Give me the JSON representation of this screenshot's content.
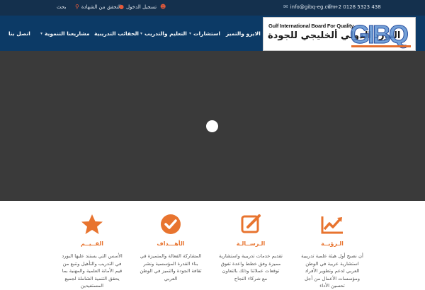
{
  "topbar": {
    "phone": "+2 0128 5323 438",
    "email": "info@gibq-eg.com",
    "login": "تسجيل الدخول",
    "verify": "التحقق من الشهادة",
    "search": "بحث"
  },
  "logo": {
    "english_name": "Gulf International Board For Quality",
    "arabic_name": "البورد الدولي ألخليجي للجودة",
    "mark_text": "GIBQ"
  },
  "nav": {
    "items": [
      {
        "label": "اتصل بنا",
        "dropdown": false
      },
      {
        "label": "مشاريعنا التنموية",
        "dropdown": true
      },
      {
        "label": "الحقائب التدريبية",
        "dropdown": false
      },
      {
        "label": "التعليم والتدريب",
        "dropdown": true
      },
      {
        "label": "استشارات",
        "dropdown": true
      },
      {
        "label": "الايزو والتميز",
        "dropdown": false
      }
    ]
  },
  "features": [
    {
      "icon": "star-icon",
      "title": "القــيــم",
      "text": "الأسس التي يستند عليها البورد في التدريب والتأهيل وتنبع من قيم الأمانة العلمية والمهنية بما يحقق التنمية الشاملة لجميع المستفيدين"
    },
    {
      "icon": "check-circle-icon",
      "title": "الأهـــداف",
      "text": "المشاركة الفعالة والمتميزة في بناء القدرة المؤسسية ونشر ثقافة الجودة والتميز في الوطن العربي"
    },
    {
      "icon": "edit-icon",
      "title": "الـرســالـة",
      "text": "تقديم خدمات تدريبية واستشارية مميزة وفق خطط واعدة تفوق توقعات عملائنا وذلك بالتعاون مع شركاء النجاح"
    },
    {
      "icon": "trend-chart-icon",
      "title": "الـرؤيــة",
      "text": "أن نصبح أول هيئة علمية تدريبية استشارية عربية في الوطن العربي لدعم وتطوير الأفراد ومؤسسات الأعمال من أجل تحسين الأداء"
    }
  ],
  "colors": {
    "topbar": "#14304d",
    "navbar": "#0c3a66",
    "accent": "#e8742f",
    "hero": "#3a3a3a"
  }
}
